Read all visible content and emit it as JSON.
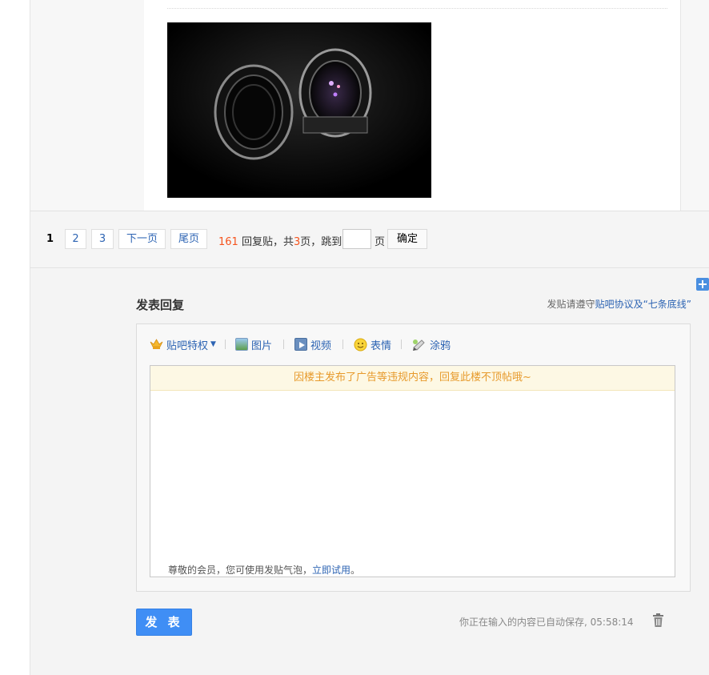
{
  "pager": {
    "current": "1",
    "pages": [
      "2",
      "3"
    ],
    "next": "下一页",
    "last": "尾页",
    "reply_count": "161",
    "reply_label": "回复贴，共",
    "total_pages": "3",
    "jump_label": "页，跳到",
    "page_label": "页",
    "confirm": "确定"
  },
  "reply": {
    "title": "发表回复",
    "notice_prefix": "发贴请遵守",
    "notice_link": "贴吧协议及“七条底线”",
    "toolbar": {
      "privilege": "贴吧特权",
      "image": "图片",
      "video": "视频",
      "emoji": "表情",
      "doodle": "涂鸦"
    },
    "warning": "因楼主发布了广告等违规内容，回复此楼不顶帖哦~",
    "hint_prefix": "尊敬的会员，您可使用发贴气泡，",
    "hint_link": "立即试用",
    "hint_suffix": "。",
    "submit": "发 表",
    "autosave": "你正在输入的内容已自动保存, 05:58:14"
  },
  "colors": {
    "link": "#2d64b3",
    "accent": "#3f8ef5",
    "warning_text": "#e79a2c",
    "count_red": "#f5541e"
  },
  "icons": [
    "crown-icon",
    "image-icon",
    "video-icon",
    "emoji-icon",
    "doodle-icon",
    "trash-icon",
    "plus-icon"
  ]
}
